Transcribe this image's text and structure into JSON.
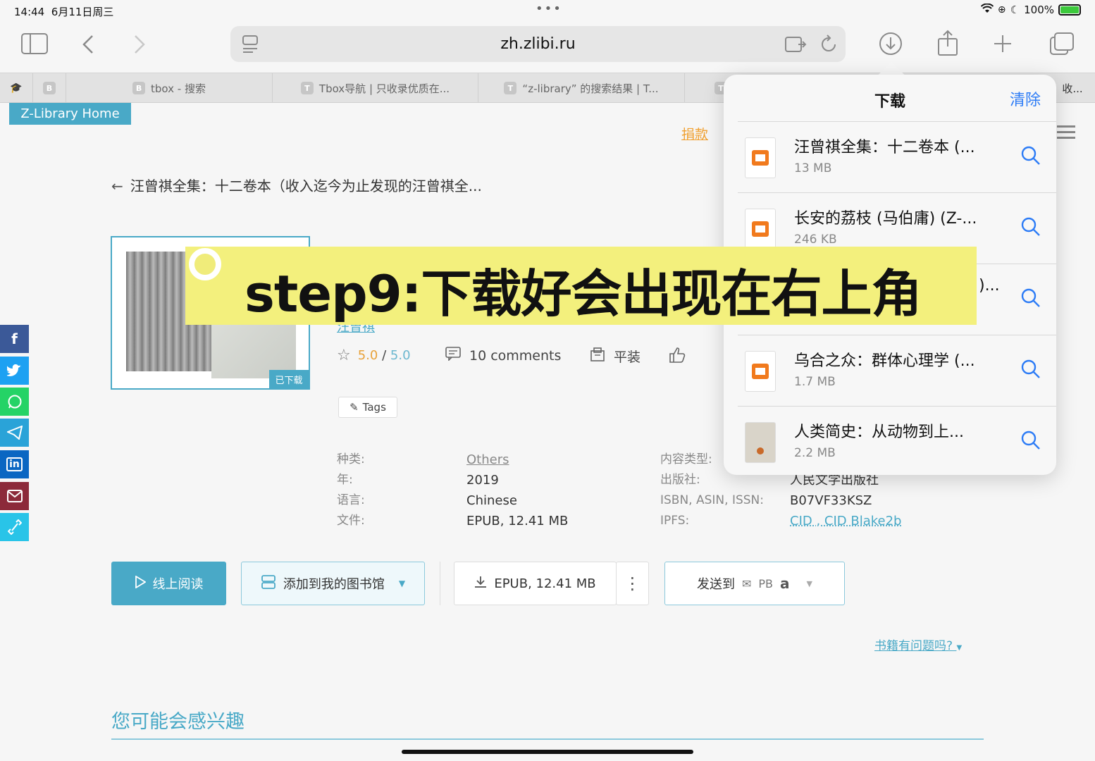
{
  "status": {
    "time": "14:44",
    "date": "6月11日周三",
    "battery": "100%"
  },
  "browser": {
    "url": "zh.zlibi.ru"
  },
  "tabs": [
    {
      "icon": "B",
      "label": ""
    },
    {
      "icon": "B",
      "label": "tbox - 搜索"
    },
    {
      "icon": "T",
      "label": "Tbox导航 | 只收录优质在..."
    },
    {
      "icon": "T",
      "label": "“z-library” 的搜索结果 | T..."
    },
    {
      "icon": "T",
      "label": ""
    },
    {
      "icon": "",
      "label": "收..."
    }
  ],
  "page": {
    "home_button": "Z-Library Home",
    "donate": "捐款",
    "back_title": "汪曾祺全集：十二卷本（收入迄今为止发现的汪曾祺全...",
    "cover_badge": "已下载",
    "author_partial": "汪曾祺",
    "rating": {
      "value": "5.0",
      "separator": "/",
      "max": "5.0"
    },
    "comments": "10 comments",
    "binding": "平装",
    "tags_label": "Tags",
    "props_left": [
      {
        "label": "种类:",
        "value": "Others",
        "link": true
      },
      {
        "label": "年:",
        "value": "2019",
        "link": false
      },
      {
        "label": "语言:",
        "value": "Chinese",
        "link": false
      },
      {
        "label": "文件:",
        "value": "EPUB, 12.41 MB",
        "link": false
      }
    ],
    "props_right": [
      {
        "label": "内容类型:",
        "value": ""
      },
      {
        "label": "出版社:",
        "value": "人民文学出版社"
      },
      {
        "label": "ISBN, ASIN, ISSN:",
        "value": "B07VF33KSZ"
      },
      {
        "label": "IPFS:",
        "value": "CID , CID Blake2b"
      }
    ],
    "buttons": {
      "read": "线上阅读",
      "add": "添加到我的图书馆",
      "epub": "EPUB, 12.41 MB",
      "send": "发送到",
      "send_targets": "PB"
    },
    "issue_link": "书籍有问题吗?",
    "interest_heading": "您可能会感兴趣"
  },
  "downloads": {
    "title": "下载",
    "clear": "清除",
    "items": [
      {
        "name": "汪曾祺全集：十二卷本 (...",
        "size": "13 MB",
        "kind": "book"
      },
      {
        "name": "长安的荔枝 (马伯庸) (Z-...",
        "size": "246 KB",
        "kind": "book"
      },
      {
        "name": ")...",
        "size": "",
        "kind": "book"
      },
      {
        "name": "乌合之众：群体心理学 (...",
        "size": "1.7 MB",
        "kind": "book"
      },
      {
        "name": "人类简史：从动物到上...",
        "size": "2.2 MB",
        "kind": "thumb"
      }
    ]
  },
  "overlay": {
    "caption": "step9:下载好会出现在右上角"
  }
}
